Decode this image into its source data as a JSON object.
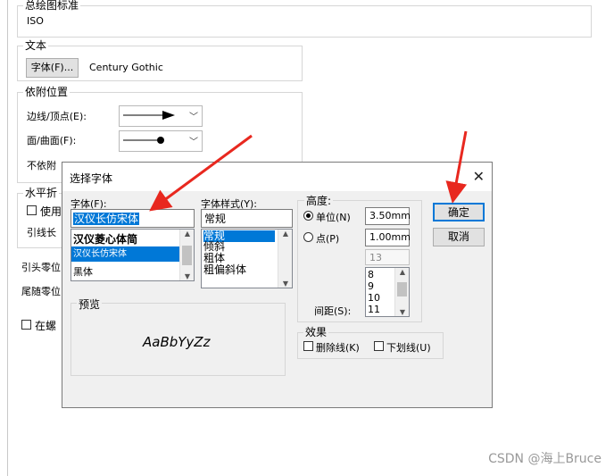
{
  "background": {
    "drawing_standard_title": "总绘图标准",
    "drawing_standard_value": "ISO",
    "text_group_title": "文本",
    "font_button_label": "字体(F)...",
    "font_name": "Century Gothic",
    "attach_group_title": "依附位置",
    "edge_vertex_label": "边线/顶点(E):",
    "face_label": "面/曲面(F):",
    "no_attach_label": "不依附",
    "horizontal_group_title": "水平折",
    "use_label": "使用",
    "leader_label": "引线长",
    "leader_zero_label": "引头零位",
    "tail_zero_label": "尾随零位",
    "bolt_label": "在螺"
  },
  "dialog": {
    "title": "选择字体",
    "font_label": "字体(F):",
    "font_input_value": "汉仪长仿宋体",
    "font_list": [
      "汉仪菱心体简",
      "汉仪长仿宋体",
      "黑体"
    ],
    "font_list_selected_index": 1,
    "style_label": "字体样式(Y):",
    "style_input_value": "常规",
    "style_list": [
      "常规",
      "倾斜",
      "粗体",
      "粗偏斜体"
    ],
    "style_list_selected_index": 0,
    "height_group_title": "高度:",
    "units_label": "单位(N)",
    "units_value": "3.50mm",
    "points_label": "点(P)",
    "points_value": "1.00mm",
    "points_size_value": "13",
    "size_list": [
      "8",
      "9",
      "10",
      "11"
    ],
    "spacing_label": "间距(S):",
    "spacing_value": "",
    "ok_label": "确定",
    "cancel_label": "取消",
    "preview_group_title": "预览",
    "preview_text": "AaBbYyZz",
    "effects_group_title": "效果",
    "strikeout_label": "删除线(K)",
    "underline_label": "下划线(U)",
    "selected_radio": "units"
  },
  "watermark": "CSDN @海上Bruce",
  "colors": {
    "selection": "#0078d7",
    "annotation_arrow": "#e8281f",
    "dialog_bg": "#f0f0f0"
  }
}
